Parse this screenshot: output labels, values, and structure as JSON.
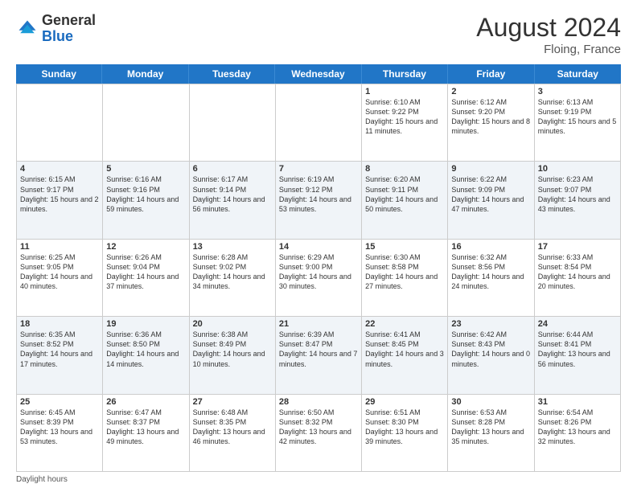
{
  "header": {
    "logo_general": "General",
    "logo_blue": "Blue",
    "month_year": "August 2024",
    "location": "Floing, France"
  },
  "days_of_week": [
    "Sunday",
    "Monday",
    "Tuesday",
    "Wednesday",
    "Thursday",
    "Friday",
    "Saturday"
  ],
  "footer": {
    "daylight_label": "Daylight hours"
  },
  "weeks": [
    [
      {
        "date": "",
        "info": ""
      },
      {
        "date": "",
        "info": ""
      },
      {
        "date": "",
        "info": ""
      },
      {
        "date": "",
        "info": ""
      },
      {
        "date": "1",
        "info": "Sunrise: 6:10 AM\nSunset: 9:22 PM\nDaylight: 15 hours and 11 minutes."
      },
      {
        "date": "2",
        "info": "Sunrise: 6:12 AM\nSunset: 9:20 PM\nDaylight: 15 hours and 8 minutes."
      },
      {
        "date": "3",
        "info": "Sunrise: 6:13 AM\nSunset: 9:19 PM\nDaylight: 15 hours and 5 minutes."
      }
    ],
    [
      {
        "date": "4",
        "info": "Sunrise: 6:15 AM\nSunset: 9:17 PM\nDaylight: 15 hours and 2 minutes."
      },
      {
        "date": "5",
        "info": "Sunrise: 6:16 AM\nSunset: 9:16 PM\nDaylight: 14 hours and 59 minutes."
      },
      {
        "date": "6",
        "info": "Sunrise: 6:17 AM\nSunset: 9:14 PM\nDaylight: 14 hours and 56 minutes."
      },
      {
        "date": "7",
        "info": "Sunrise: 6:19 AM\nSunset: 9:12 PM\nDaylight: 14 hours and 53 minutes."
      },
      {
        "date": "8",
        "info": "Sunrise: 6:20 AM\nSunset: 9:11 PM\nDaylight: 14 hours and 50 minutes."
      },
      {
        "date": "9",
        "info": "Sunrise: 6:22 AM\nSunset: 9:09 PM\nDaylight: 14 hours and 47 minutes."
      },
      {
        "date": "10",
        "info": "Sunrise: 6:23 AM\nSunset: 9:07 PM\nDaylight: 14 hours and 43 minutes."
      }
    ],
    [
      {
        "date": "11",
        "info": "Sunrise: 6:25 AM\nSunset: 9:05 PM\nDaylight: 14 hours and 40 minutes."
      },
      {
        "date": "12",
        "info": "Sunrise: 6:26 AM\nSunset: 9:04 PM\nDaylight: 14 hours and 37 minutes."
      },
      {
        "date": "13",
        "info": "Sunrise: 6:28 AM\nSunset: 9:02 PM\nDaylight: 14 hours and 34 minutes."
      },
      {
        "date": "14",
        "info": "Sunrise: 6:29 AM\nSunset: 9:00 PM\nDaylight: 14 hours and 30 minutes."
      },
      {
        "date": "15",
        "info": "Sunrise: 6:30 AM\nSunset: 8:58 PM\nDaylight: 14 hours and 27 minutes."
      },
      {
        "date": "16",
        "info": "Sunrise: 6:32 AM\nSunset: 8:56 PM\nDaylight: 14 hours and 24 minutes."
      },
      {
        "date": "17",
        "info": "Sunrise: 6:33 AM\nSunset: 8:54 PM\nDaylight: 14 hours and 20 minutes."
      }
    ],
    [
      {
        "date": "18",
        "info": "Sunrise: 6:35 AM\nSunset: 8:52 PM\nDaylight: 14 hours and 17 minutes."
      },
      {
        "date": "19",
        "info": "Sunrise: 6:36 AM\nSunset: 8:50 PM\nDaylight: 14 hours and 14 minutes."
      },
      {
        "date": "20",
        "info": "Sunrise: 6:38 AM\nSunset: 8:49 PM\nDaylight: 14 hours and 10 minutes."
      },
      {
        "date": "21",
        "info": "Sunrise: 6:39 AM\nSunset: 8:47 PM\nDaylight: 14 hours and 7 minutes."
      },
      {
        "date": "22",
        "info": "Sunrise: 6:41 AM\nSunset: 8:45 PM\nDaylight: 14 hours and 3 minutes."
      },
      {
        "date": "23",
        "info": "Sunrise: 6:42 AM\nSunset: 8:43 PM\nDaylight: 14 hours and 0 minutes."
      },
      {
        "date": "24",
        "info": "Sunrise: 6:44 AM\nSunset: 8:41 PM\nDaylight: 13 hours and 56 minutes."
      }
    ],
    [
      {
        "date": "25",
        "info": "Sunrise: 6:45 AM\nSunset: 8:39 PM\nDaylight: 13 hours and 53 minutes."
      },
      {
        "date": "26",
        "info": "Sunrise: 6:47 AM\nSunset: 8:37 PM\nDaylight: 13 hours and 49 minutes."
      },
      {
        "date": "27",
        "info": "Sunrise: 6:48 AM\nSunset: 8:35 PM\nDaylight: 13 hours and 46 minutes."
      },
      {
        "date": "28",
        "info": "Sunrise: 6:50 AM\nSunset: 8:32 PM\nDaylight: 13 hours and 42 minutes."
      },
      {
        "date": "29",
        "info": "Sunrise: 6:51 AM\nSunset: 8:30 PM\nDaylight: 13 hours and 39 minutes."
      },
      {
        "date": "30",
        "info": "Sunrise: 6:53 AM\nSunset: 8:28 PM\nDaylight: 13 hours and 35 minutes."
      },
      {
        "date": "31",
        "info": "Sunrise: 6:54 AM\nSunset: 8:26 PM\nDaylight: 13 hours and 32 minutes."
      }
    ]
  ]
}
